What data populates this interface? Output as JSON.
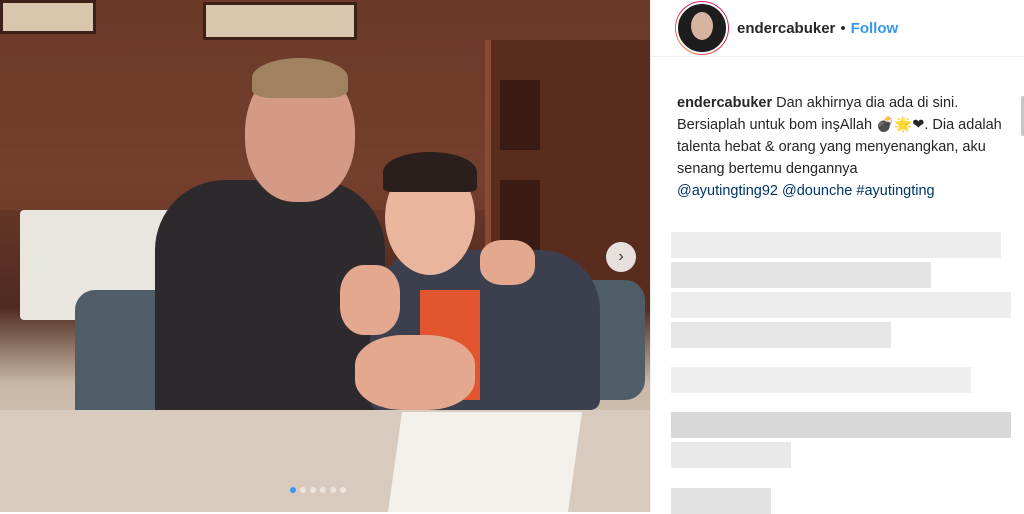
{
  "post": {
    "username": "endercabuker",
    "separator": "•",
    "follow_label": "Follow",
    "caption_text": " Dan akhirnya dia ada di sini. Bersiaplah untuk bom inşAllah 💣🌟❤. Dia adalah talenta hebat & orang yang menyenangkan, aku senang bertemu dengannya",
    "tags": "@ayutingting92 @dounche #ayutingting"
  },
  "carousel": {
    "next_icon": "›",
    "dots": 6,
    "active_dot": 0
  },
  "colors": {
    "follow": "#3897f0",
    "text": "#262626",
    "link": "#003569"
  }
}
